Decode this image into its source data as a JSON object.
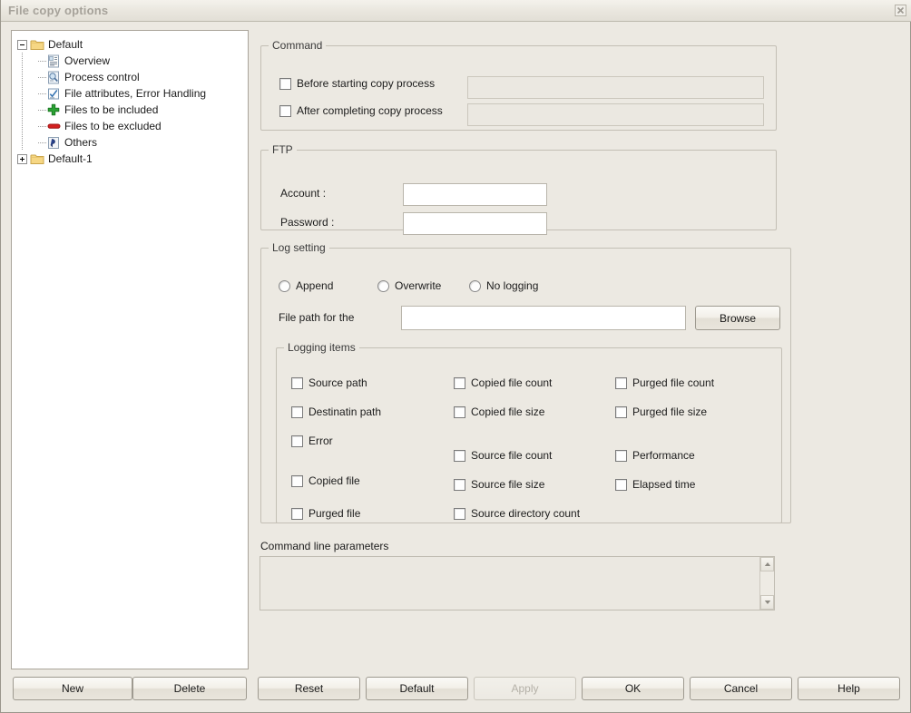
{
  "window": {
    "title": "File copy options",
    "close_icon": "close-icon"
  },
  "tree": {
    "nodes": [
      {
        "label": "Default",
        "icon": "folder-icon",
        "expander": "minus",
        "level": 0
      },
      {
        "label": "Overview",
        "icon": "overview-document-icon",
        "expander": "none",
        "level": 1
      },
      {
        "label": "Process control",
        "icon": "process-control-icon",
        "expander": "none",
        "level": 1
      },
      {
        "label": "File attributes, Error Handling",
        "icon": "file-attributes-icon",
        "expander": "none",
        "level": 1
      },
      {
        "label": "Files to be included",
        "icon": "green-plus-icon",
        "expander": "none",
        "level": 1
      },
      {
        "label": "Files to be excluded",
        "icon": "red-minus-icon",
        "expander": "none",
        "level": 1
      },
      {
        "label": "Others",
        "icon": "others-flag-icon",
        "expander": "none",
        "level": 1
      },
      {
        "label": "Default-1",
        "icon": "folder-icon",
        "expander": "plus",
        "level": 0
      }
    ]
  },
  "command": {
    "legend": "Command",
    "before": {
      "label": "Before starting copy process",
      "checked": false,
      "value": "",
      "placeholder": ""
    },
    "after": {
      "label": "After completing copy process",
      "checked": false,
      "value": "",
      "placeholder": ""
    }
  },
  "ftp": {
    "legend": "FTP",
    "account_label": "Account :",
    "account_value": "",
    "password_label": "Password :",
    "password_value": ""
  },
  "log_setting": {
    "legend": "Log setting",
    "modes": [
      {
        "label": "Append",
        "selected": false
      },
      {
        "label": "Overwrite",
        "selected": false
      },
      {
        "label": "No logging",
        "selected": false
      }
    ],
    "file_path_label": "File path for the",
    "file_path_value": "",
    "browse_label": "Browse",
    "logging_items": {
      "legend": "Logging items",
      "column1": [
        {
          "label": "Source path",
          "checked": false
        },
        {
          "label": "Destinatin path",
          "checked": false
        },
        {
          "label": "Error",
          "checked": false
        },
        {
          "label": "Copied file",
          "checked": false
        },
        {
          "label": "Purged file",
          "checked": false
        }
      ],
      "column2": [
        {
          "label": "Copied file count",
          "checked": false
        },
        {
          "label": "Copied file size",
          "checked": false
        },
        {
          "label": "Source file count",
          "checked": false
        },
        {
          "label": "Source file size",
          "checked": false
        },
        {
          "label": "Source directory count",
          "checked": false
        }
      ],
      "column3": [
        {
          "label": "Purged file count",
          "checked": false
        },
        {
          "label": "Purged file size",
          "checked": false
        },
        {
          "label": "Performance",
          "checked": false
        },
        {
          "label": "Elapsed time",
          "checked": false
        }
      ]
    }
  },
  "command_line": {
    "label": "Command line parameters",
    "value": "",
    "scroll_up_icon": "chevron-up-icon",
    "scroll_down_icon": "chevron-down-icon"
  },
  "buttons": {
    "new": "New",
    "delete": "Delete",
    "reset": "Reset",
    "default": "Default",
    "apply": "Apply",
    "apply_disabled": true,
    "ok": "OK",
    "cancel": "Cancel",
    "help": "Help"
  },
  "colors": {
    "window_bg": "#ece9e2",
    "panel_bg": "#ffffff",
    "group_border": "#c3bfb5",
    "title_text": "#a6a29a",
    "folder": "#f5d681",
    "plus_green": "#2aa233",
    "minus_red": "#d42020"
  }
}
